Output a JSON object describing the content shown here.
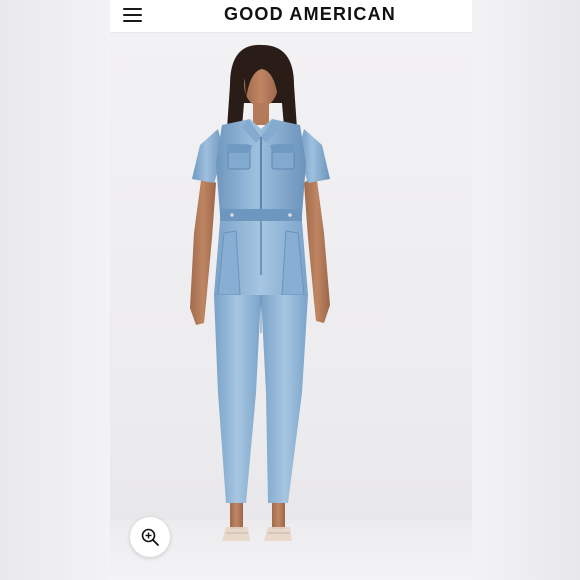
{
  "header": {
    "brand": "GOOD AMERICAN",
    "menu_icon": "hamburger-menu-icon"
  },
  "product": {
    "zoom_icon": "zoom-in-icon",
    "colors": {
      "denim_light": "#8fb4d6",
      "denim_mid": "#7aa3c8",
      "denim_dark": "#5f88b0",
      "background": "#f1f0f2"
    }
  }
}
